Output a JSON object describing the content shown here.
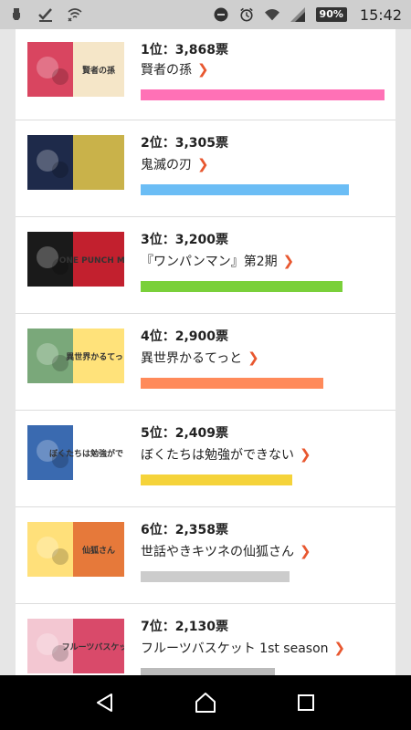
{
  "status_bar": {
    "battery": "90%",
    "time": "15:42",
    "icons": [
      "usb-icon",
      "check-icon",
      "wifi-x-icon",
      "do-not-disturb-icon",
      "alarm-icon",
      "wifi-icon",
      "signal-icon",
      "battery-icon"
    ]
  },
  "ranking": [
    {
      "rank_label": "1位：3,868票",
      "title": "賢者の孫",
      "votes": 3868,
      "bar_color": "#ff71b6",
      "thumb_colors": [
        "#d94560",
        "#f5e6c8"
      ],
      "thumb_text": "賢者の孫"
    },
    {
      "rank_label": "2位：3,305票",
      "title": "鬼滅の刃",
      "votes": 3305,
      "bar_color": "#6bbdf5",
      "thumb_colors": [
        "#1e2a4a",
        "#c9b24a"
      ],
      "thumb_text": ""
    },
    {
      "rank_label": "3位：3,200票",
      "title": "『ワンパンマン』第2期",
      "votes": 3200,
      "bar_color": "#7ad03a",
      "thumb_colors": [
        "#1a1a1a",
        "#c2202e"
      ],
      "thumb_text": "ONE PUNCH MAN"
    },
    {
      "rank_label": "4位：2,900票",
      "title": "異世界かるてっと",
      "votes": 2900,
      "bar_color": "#ff8a5a",
      "thumb_colors": [
        "#7aa87a",
        "#ffe27a"
      ],
      "thumb_text": "異世界かるてっと"
    },
    {
      "rank_label": "5位：2,409票",
      "title": "ぼくたちは勉強ができない",
      "votes": 2409,
      "bar_color": "#f5d33a",
      "thumb_colors": [
        "#3a6ab0",
        "#ffffff"
      ],
      "thumb_text": "ぼくたちは勉強ができない"
    },
    {
      "rank_label": "6位：2,358票",
      "title": "世話やきキツネの仙狐さん",
      "votes": 2358,
      "bar_color": "#cccccc",
      "thumb_colors": [
        "#ffe07a",
        "#e6793a"
      ],
      "thumb_text": "仙狐さん"
    },
    {
      "rank_label": "7位：2,130票",
      "title": "フルーツバスケット 1st season",
      "votes": 2130,
      "bar_color": "#bbbbbb",
      "thumb_colors": [
        "#f3c7d2",
        "#d94a6a"
      ],
      "thumb_text": "フルーツバスケット"
    }
  ],
  "nav": {
    "back": "back-icon",
    "home": "home-icon",
    "recents": "recents-icon"
  },
  "colors": {
    "chevron": "#e8572f",
    "divider": "#dcdcdc"
  }
}
